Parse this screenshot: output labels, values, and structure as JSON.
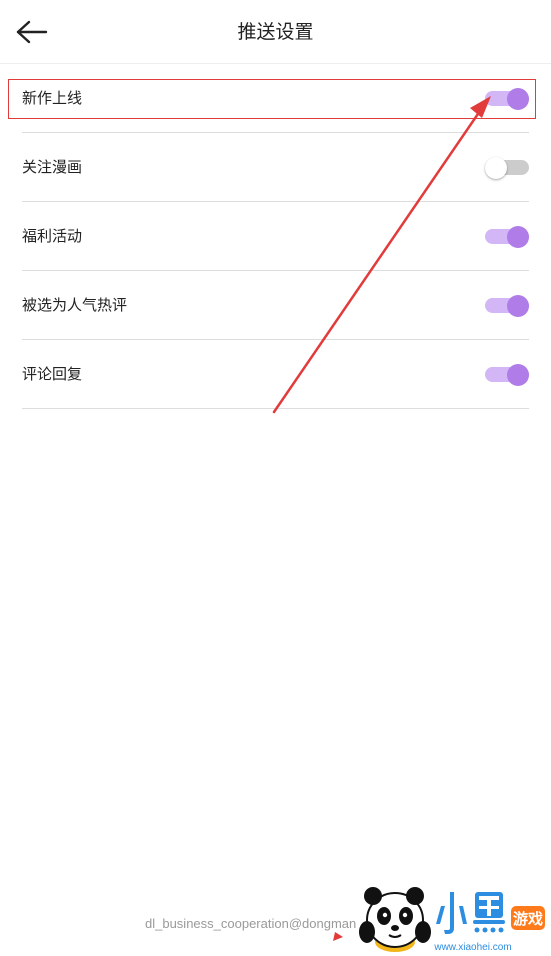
{
  "header": {
    "title": "推送设置",
    "back_icon": "arrow-left-icon"
  },
  "settings": [
    {
      "label": "新作上线",
      "enabled": true,
      "highlighted": true
    },
    {
      "label": "关注漫画",
      "enabled": false,
      "highlighted": false
    },
    {
      "label": "福利活动",
      "enabled": true,
      "highlighted": false
    },
    {
      "label": "被选为人气热评",
      "enabled": true,
      "highlighted": false
    },
    {
      "label": "评论回复",
      "enabled": true,
      "highlighted": false
    }
  ],
  "footer": {
    "email": "dl_business_cooperation@dongman"
  },
  "watermark": {
    "brand_text": "小黑游戏",
    "site": "www.xiaohei.com"
  },
  "colors": {
    "toggle_on_track": "#d3b6f5",
    "toggle_on_knob": "#b07ce8",
    "toggle_off_track": "#cccccc",
    "annotation_red": "#e23b3b"
  }
}
